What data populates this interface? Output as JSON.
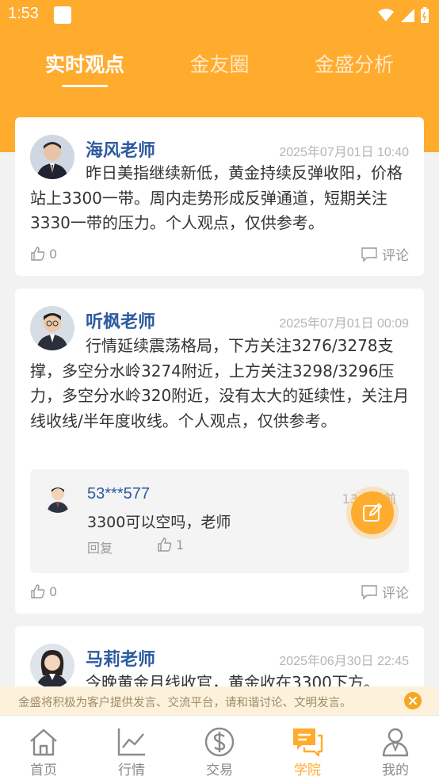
{
  "status_bar": {
    "time": "1:53"
  },
  "tabs": [
    {
      "label": "实时观点",
      "active": true
    },
    {
      "label": "金友圈",
      "active": false
    },
    {
      "label": "金盛分析",
      "active": false
    }
  ],
  "posts": [
    {
      "author": "海风老师",
      "date": "2025年07月01日 10:40",
      "content": "昨日美指继续新低，黄金持续反弹收阳，价格站上3300一带。周内走势形成反弹通道，短期关注3330一带的压力。个人观点，仅供参考。",
      "likes": "0",
      "comment_label": "评论"
    },
    {
      "author": "听枫老师",
      "date": "2025年07月01日 00:09",
      "content": "行情延续震荡格局，下方关注3276/3278支撑，多空分水岭3274附近，上方关注3298/3296压力，多空分水岭320附近，没有太大的延续性，关注月线收线/半年度收线。个人观点，仅供参考。",
      "likes": "0",
      "comment_label": "评论",
      "reply": {
        "user": "53***577",
        "time": "13小时前",
        "text": "3300可以空吗，老师",
        "reply_label": "回复",
        "likes": "1"
      }
    },
    {
      "author": "马莉老师",
      "date": "2025年06月30日 22:45",
      "content": "今晚黄金月线收官，黄金收在3300下方。"
    }
  ],
  "notice": {
    "text": "金盛将积极为客户提供发言、交流平台，请和谐讨论、文明发言。"
  },
  "bottom_nav": [
    {
      "label": "首页",
      "icon": "home-icon",
      "active": false
    },
    {
      "label": "行情",
      "icon": "chart-icon",
      "active": false
    },
    {
      "label": "交易",
      "icon": "dollar-icon",
      "active": false
    },
    {
      "label": "学院",
      "icon": "chat-icon",
      "active": true
    },
    {
      "label": "我的",
      "icon": "person-icon",
      "active": false
    }
  ],
  "colors": {
    "accent": "#ffab2e",
    "author": "#2d5aa0"
  }
}
